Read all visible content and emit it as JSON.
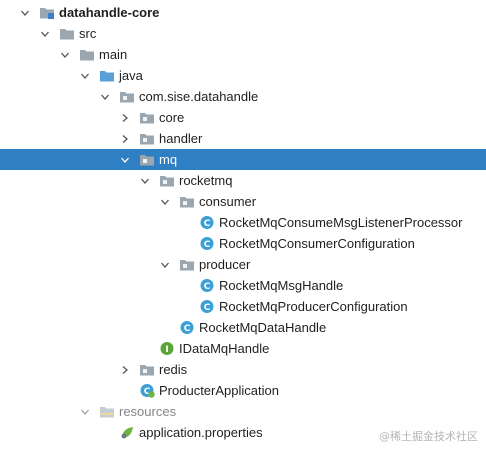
{
  "tree": {
    "nodes": [
      {
        "name": "tree-item-datahandle-core",
        "label": "datahandle-core",
        "depth": 0,
        "arrow": "down",
        "icon": "module-folder-icon",
        "bold": true
      },
      {
        "name": "tree-item-src",
        "label": "src",
        "depth": 1,
        "arrow": "down",
        "icon": "folder-icon"
      },
      {
        "name": "tree-item-main",
        "label": "main",
        "depth": 2,
        "arrow": "down",
        "icon": "folder-icon"
      },
      {
        "name": "tree-item-java",
        "label": "java",
        "depth": 3,
        "arrow": "down",
        "icon": "source-folder-icon"
      },
      {
        "name": "tree-item-com-sise-datahandle",
        "label": "com.sise.datahandle",
        "depth": 4,
        "arrow": "down",
        "icon": "package-icon"
      },
      {
        "name": "tree-item-core",
        "label": "core",
        "depth": 5,
        "arrow": "right",
        "icon": "package-icon"
      },
      {
        "name": "tree-item-handler",
        "label": "handler",
        "depth": 5,
        "arrow": "right",
        "icon": "package-icon"
      },
      {
        "name": "tree-item-mq",
        "label": "mq",
        "depth": 5,
        "arrow": "down",
        "icon": "package-icon",
        "selected": true
      },
      {
        "name": "tree-item-rocketmq",
        "label": "rocketmq",
        "depth": 6,
        "arrow": "down",
        "icon": "package-icon"
      },
      {
        "name": "tree-item-consumer",
        "label": "consumer",
        "depth": 7,
        "arrow": "down",
        "icon": "package-icon"
      },
      {
        "name": "tree-item-rocketmq-consume-msg-listener-processor",
        "label": "RocketMqConsumeMsgListenerProcessor",
        "depth": 8,
        "arrow": "none",
        "icon": "class-icon"
      },
      {
        "name": "tree-item-rocketmq-consumer-configuration",
        "label": "RocketMqConsumerConfiguration",
        "depth": 8,
        "arrow": "none",
        "icon": "class-icon"
      },
      {
        "name": "tree-item-producer",
        "label": "producer",
        "depth": 7,
        "arrow": "down",
        "icon": "package-icon"
      },
      {
        "name": "tree-item-rocketmq-msg-handle",
        "label": "RocketMqMsgHandle",
        "depth": 8,
        "arrow": "none",
        "icon": "class-icon"
      },
      {
        "name": "tree-item-rocketmq-producer-configuration",
        "label": "RocketMqProducerConfiguration",
        "depth": 8,
        "arrow": "none",
        "icon": "class-icon"
      },
      {
        "name": "tree-item-rocketmq-data-handle",
        "label": "RocketMqDataHandle",
        "depth": 7,
        "arrow": "none",
        "icon": "class-icon"
      },
      {
        "name": "tree-item-idatamq-handle",
        "label": "IDataMqHandle",
        "depth": 6,
        "arrow": "none",
        "icon": "interface-icon"
      },
      {
        "name": "tree-item-redis",
        "label": "redis",
        "depth": 5,
        "arrow": "right",
        "icon": "package-icon"
      },
      {
        "name": "tree-item-producter-application",
        "label": "ProducterApplication",
        "depth": 5,
        "arrow": "none",
        "icon": "spring-app-icon"
      },
      {
        "name": "tree-item-resources",
        "label": "resources",
        "depth": 3,
        "arrow": "down",
        "icon": "resources-folder-icon",
        "faded": true
      },
      {
        "name": "tree-item-application-properties",
        "label": "application.properties",
        "depth": 4,
        "arrow": "none",
        "icon": "properties-icon"
      }
    ]
  },
  "watermark": "@稀土掘金技术社区",
  "colors": {
    "selection": "#2f7fc4",
    "folder": "#9aa7b0",
    "source_folder": "#5aa0d8",
    "class_circle": "#3c9fd6",
    "interface_circle": "#5aa63a",
    "spring_green": "#6db33f"
  }
}
